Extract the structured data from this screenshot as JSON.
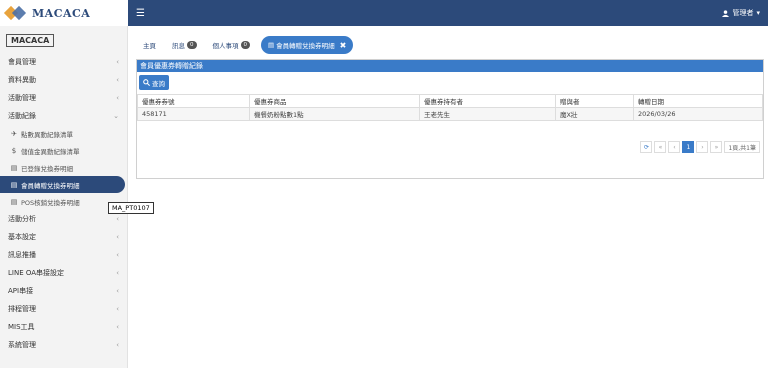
{
  "logo": {
    "brand": "MACACA"
  },
  "navbar": {
    "menu_icon": "☰",
    "user_label": "管理者",
    "user_icon": "user-icon"
  },
  "sidebar": {
    "brand_box": "MACACA",
    "items": [
      {
        "label": "會員管理"
      },
      {
        "label": "資料異動"
      },
      {
        "label": "活動管理"
      },
      {
        "label": "活動紀錄"
      }
    ],
    "sub_items": [
      {
        "label": "點數異動紀錄清單",
        "icon": "✈"
      },
      {
        "label": "儲值金異動紀錄清單",
        "icon": "$"
      },
      {
        "label": "已登錄兌換券明細",
        "icon": "▤"
      },
      {
        "label": "會員轉贈兌換券明細",
        "icon": "▤"
      },
      {
        "label": "POS核銷兌換券明細",
        "icon": "▤"
      }
    ],
    "items_after": [
      {
        "label": "活動分析"
      },
      {
        "label": "基本設定"
      },
      {
        "label": "訊息推播"
      },
      {
        "label": "LINE OA串接設定"
      },
      {
        "label": "API串接"
      },
      {
        "label": "排程管理"
      },
      {
        "label": "MIS工具"
      },
      {
        "label": "系統管理"
      }
    ],
    "tooltip": "MA_PT0107"
  },
  "tabs": [
    {
      "label": "主頁",
      "badge": null
    },
    {
      "label": "訊息",
      "badge": "0"
    },
    {
      "label": "個人事項",
      "badge": "0"
    },
    {
      "label": "會員轉贈兌換券明細",
      "badge": null,
      "active": true
    }
  ],
  "panel": {
    "title": "會員優惠券轉贈紀錄",
    "query_button": "查詢",
    "columns": [
      "優惠券券號",
      "優惠券商品",
      "優惠券持有者",
      "贈與者",
      "轉贈日期"
    ],
    "rows": [
      [
        "458171",
        "機餐奶粉點數1點",
        "王老先生",
        "魔X壯",
        "2026/03/26"
      ]
    ],
    "pager": {
      "current": "1",
      "info": "1頁,共1筆"
    }
  }
}
